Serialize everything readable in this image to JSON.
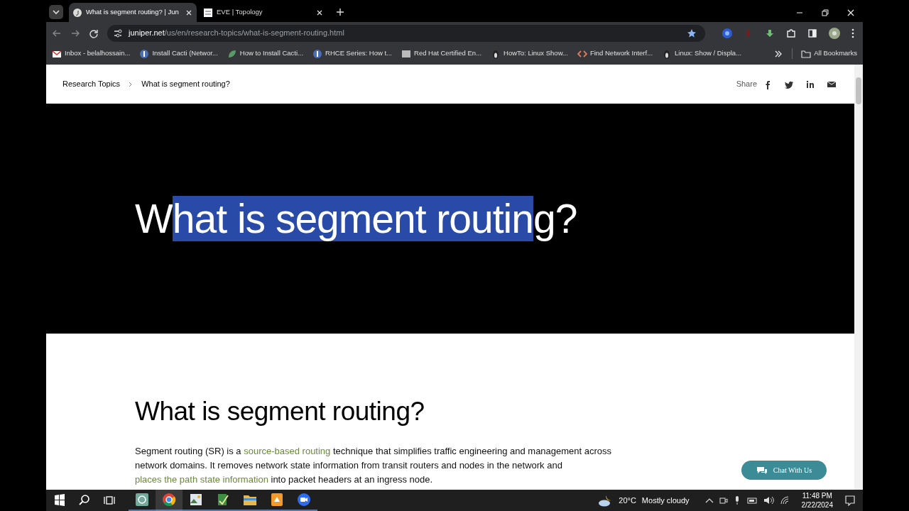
{
  "tabs": [
    {
      "title": "What is segment routing? | Jun",
      "selected": true
    },
    {
      "title": "EVE | Topology",
      "selected": false
    }
  ],
  "address": {
    "domain": "juniper.net",
    "path": "/us/en/research-topics/what-is-segment-routing.html",
    "bookmarked": true
  },
  "bookmarks": [
    "Inbox - belalhossain...",
    "Install Cacti (Networ...",
    "How to Install Cacti...",
    "RHCE Series: How t...",
    "Red Hat Certified En...",
    "HowTo: Linux Show...",
    "Find Network Interf...",
    "Linux: Show / Displa..."
  ],
  "all_bookmarks": "All Bookmarks",
  "breadcrumb": [
    "Research Topics",
    "What is segment routing?"
  ],
  "share_label": "Share",
  "hero_title": {
    "before": "W",
    "selected": "hat is segment routin",
    "after": "g?"
  },
  "section_title": "What is segment routing?",
  "paragraph": [
    {
      "kind": "text",
      "text": "Segment routing (SR) is a "
    },
    {
      "kind": "link",
      "text": "source-based routing"
    },
    {
      "kind": "text",
      "text": " technique that simplifies traffic engineering and management across network domains. It removes network state information from transit routers and nodes in the network and "
    },
    {
      "kind": "link",
      "text": "places the path state information"
    },
    {
      "kind": "text",
      "text": " into packet headers at an ingress node."
    }
  ],
  "chat_button": "Chat With Us",
  "taskbar": {
    "apps": [
      {
        "selected": false
      },
      {
        "selected": true
      },
      {
        "selected": false
      },
      {
        "selected": false
      },
      {
        "selected": false
      },
      {
        "selected": false
      },
      {
        "selected": false
      }
    ],
    "weather": {
      "temp": "20°C",
      "condition": "Mostly cloudy"
    },
    "time": "11:48 PM",
    "date": "2/22/2024"
  }
}
